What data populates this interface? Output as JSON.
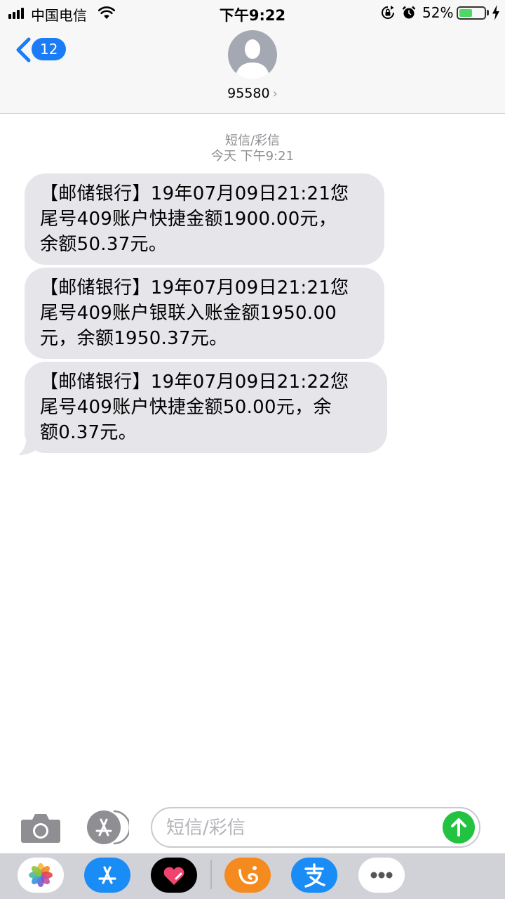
{
  "status_bar": {
    "carrier": "中国电信",
    "time": "下午9:22",
    "battery_percent": "52%",
    "battery_level": 0.52,
    "battery_color": "#4cd964"
  },
  "nav": {
    "back_count": "12",
    "contact": "95580",
    "contact_chevron": "›"
  },
  "conversation": {
    "type_label": "短信/彩信",
    "timestamp": "今天 下午9:21",
    "messages": [
      {
        "text": "【邮储银行】19年07月09日21:21您\n尾号409账户快捷金额1900.00元，\n余额50.37元。"
      },
      {
        "text": "【邮储银行】19年07月09日21:21您\n尾号409账户银联入账金额1950.00\n元，余额1950.37元。"
      },
      {
        "text": "【邮储银行】19年07月09日21:22您\n尾号409账户快捷金额50.00元，余\n额0.37元。"
      }
    ]
  },
  "input": {
    "placeholder": "短信/彩信"
  },
  "colors": {
    "accent": "#1a7cf6",
    "bubble": "#e5e5ea",
    "send": "#21c340"
  },
  "icons": {
    "camera": "camera-icon",
    "app_store": "app-store-icon",
    "send": "arrow-up-icon",
    "drawer": [
      "photos-app-icon",
      "app-store-app-icon",
      "digital-touch-app-icon",
      "uc-browser-app-icon",
      "alipay-app-icon",
      "more-apps-icon"
    ]
  }
}
